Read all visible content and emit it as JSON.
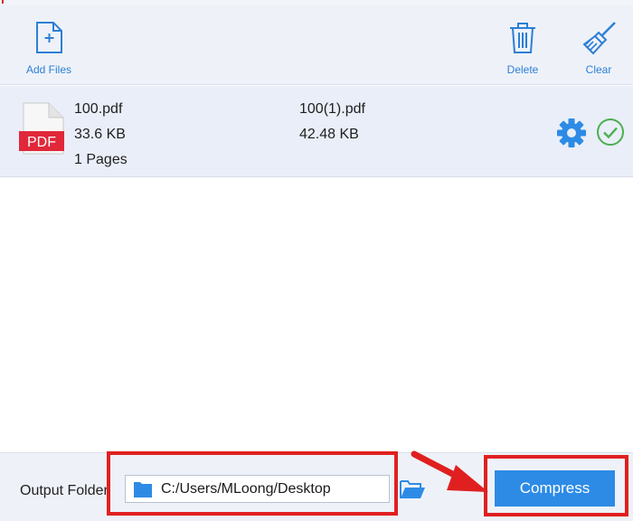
{
  "toolbar": {
    "add_files_label": "Add Files",
    "delete_label": "Delete",
    "clear_label": "Clear"
  },
  "file": {
    "icon_text": "PDF",
    "name": "100.pdf",
    "size": "33.6 KB",
    "pages": "1 Pages",
    "output_name": "100(1).pdf",
    "output_size": "42.48 KB"
  },
  "footer": {
    "output_label": "Output Folder",
    "path": "C:/Users/MLoong/Desktop",
    "compress_label": "Compress"
  },
  "colors": {
    "accent": "#2d8be6",
    "annotation": "#e02020",
    "success": "#4caf50",
    "pdf_red": "#e0283a"
  },
  "icons": [
    "add-file-icon",
    "trash-icon",
    "broom-icon",
    "pdf-file-icon",
    "gear-icon",
    "check-circle-icon",
    "folder-icon",
    "open-folder-icon"
  ]
}
